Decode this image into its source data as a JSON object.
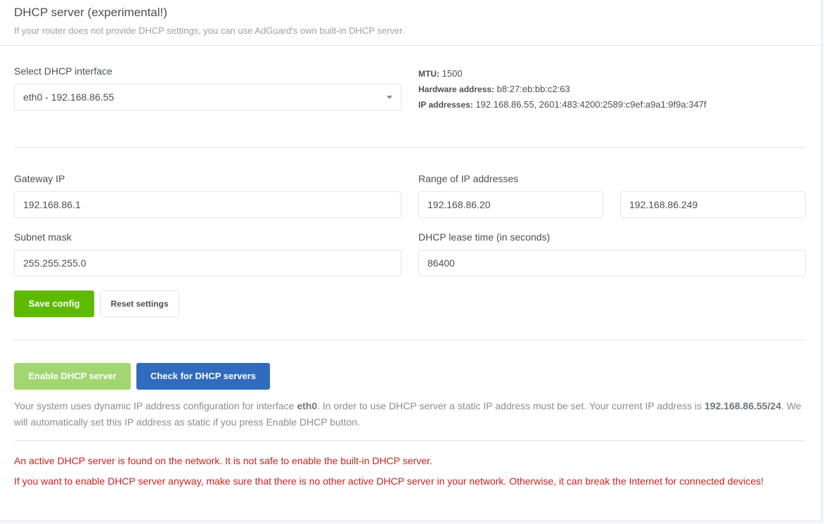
{
  "header": {
    "title": "DHCP server (experimental!)",
    "subtitle": "If your router does not provide DHCP settings, you can use AdGuard's own built-in DHCP server."
  },
  "interface": {
    "label": "Select DHCP interface",
    "selected": "eth0 - 192.168.86.55",
    "mtu_label": "MTU:",
    "mtu_value": "1500",
    "hw_label": "Hardware address:",
    "hw_value": "b8:27:eb:bb:c2:63",
    "ip_label": "IP addresses:",
    "ip_value": "192.168.86.55, 2601:483:4200:2589:c9ef:a9a1:9f9a:347f"
  },
  "form": {
    "gateway_label": "Gateway IP",
    "gateway_value": "192.168.86.1",
    "range_label": "Range of IP addresses",
    "range_start": "192.168.86.20",
    "range_end": "192.168.86.249",
    "subnet_label": "Subnet mask",
    "subnet_value": "255.255.255.0",
    "lease_label": "DHCP lease time (in seconds)",
    "lease_value": "86400"
  },
  "actions": {
    "save_label": "Save config",
    "reset_label": "Reset settings",
    "enable_label": "Enable DHCP server",
    "check_label": "Check for DHCP servers"
  },
  "notice": {
    "part1": "Your system uses dynamic IP address configuration for interface ",
    "iface": "eth0",
    "part2": ". In order to use DHCP server a static IP address must be set. Your current IP address is ",
    "ip": "192.168.86.55/24",
    "part3": ". We will automatically set this IP address as static if you press Enable DHCP button."
  },
  "warnings": {
    "found": "An active DHCP server is found on the network. It is not safe to enable the built-in DHCP server.",
    "advice": "If you want to enable DHCP server anyway, make sure that there is no other active DHCP server in your network. Otherwise, it can break the Internet for connected devices!"
  }
}
